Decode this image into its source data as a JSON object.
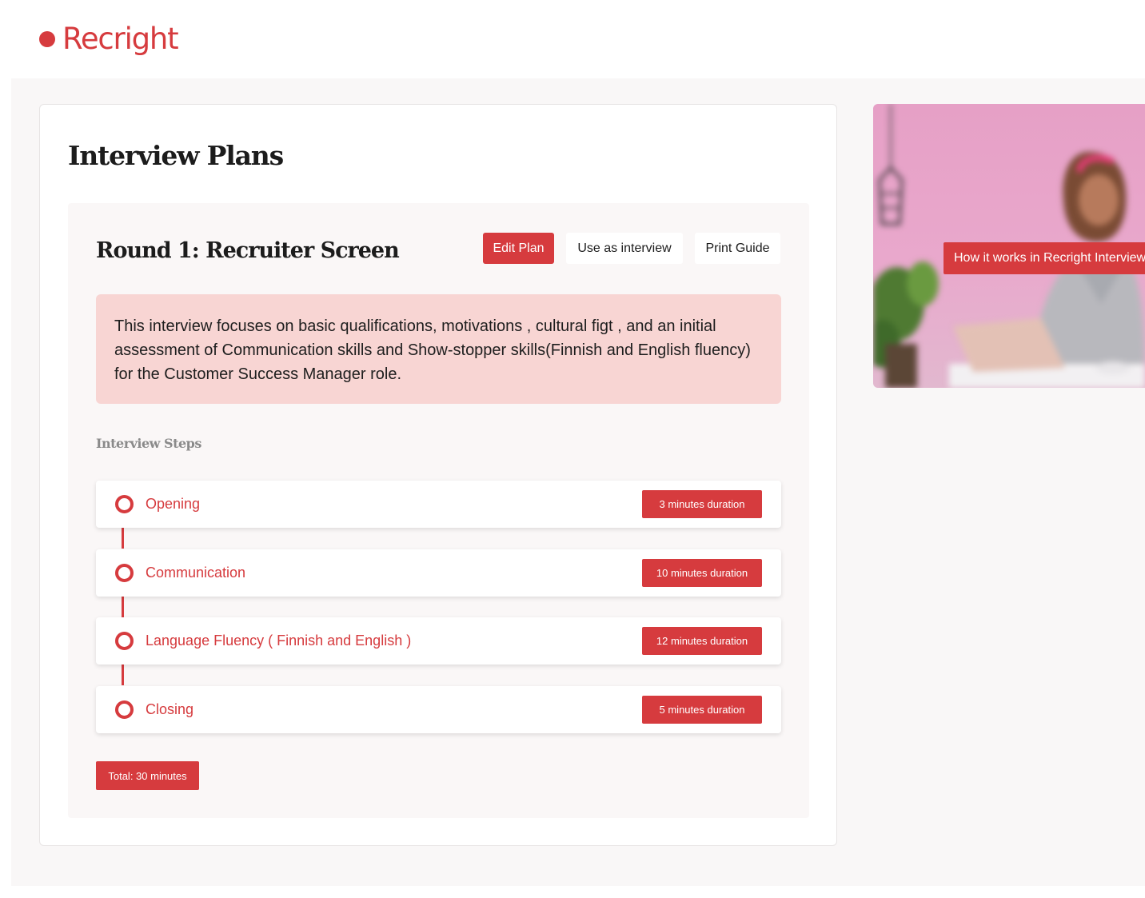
{
  "brand": {
    "name": "Recright",
    "color": "#d63b3e"
  },
  "page": {
    "title": "Interview Plans"
  },
  "plan": {
    "round_title": "Round 1:  Recruiter Screen",
    "actions": {
      "edit_plan": "Edit Plan",
      "use_as_interview": "Use as interview",
      "print_guide": "Print Guide"
    },
    "description": "This interview focuses on basic qualifications, motivations , cultural figt , and an initial assessment of Communication skills and Show-stopper skills(Finnish and English fluency) for the Customer Success Manager role.",
    "steps_label": "Interview Steps",
    "steps": [
      {
        "name": "Opening",
        "duration": "3 minutes duration"
      },
      {
        "name": "Communication",
        "duration": "10 minutes duration"
      },
      {
        "name": "Language Fluency ( Finnish and English )",
        "duration": "12 minutes duration"
      },
      {
        "name": "Closing",
        "duration": "5 minutes duration"
      }
    ],
    "total": "Total: 30 minutes"
  },
  "video": {
    "cta_label": "How it works in Recright Interview"
  },
  "icons": {
    "logo": "brand-dot-icon",
    "step": "step-circle-icon"
  }
}
